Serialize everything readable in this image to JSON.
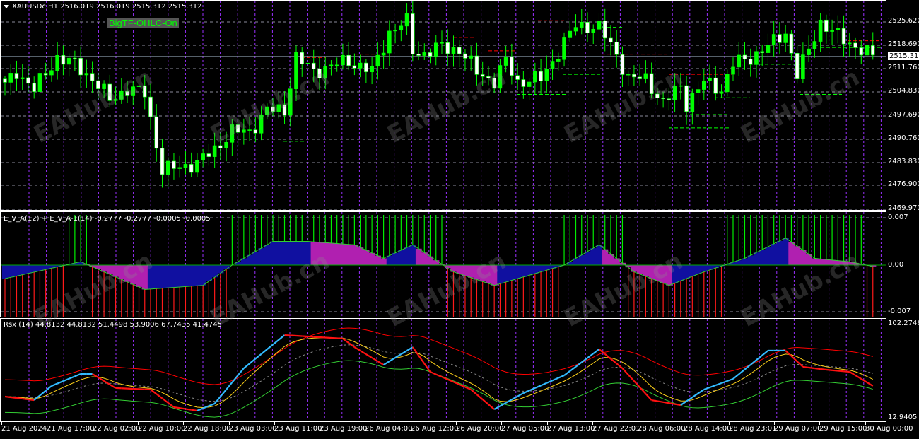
{
  "main": {
    "title": "XAUUSDc,H1  2516.019 2516.019 2515.312 2515.312",
    "badge": "BigTF-OHLC-On",
    "current_price": "2515.312",
    "price_axis": [
      "2525.620",
      "2518.690",
      "2511.760",
      "2504.830",
      "2497.690",
      "2490.760",
      "2483.830",
      "2476.900",
      "2469.970"
    ]
  },
  "indicator1": {
    "label": "E_V_A(12) + E_V_A-1(14) -0.2777 -0.2777 -0.0005 -0.0005",
    "axis": [
      "0.007",
      "0.00",
      "-0.007"
    ]
  },
  "indicator2": {
    "label": "Rsx (14) 44.8132 44.8132 51.4498 53.9006 67.7435 41.4745",
    "axis": [
      "102.2746",
      "12.9405"
    ]
  },
  "time_axis": [
    "21 Aug 2024",
    "21 Aug 17:00",
    "22 Aug 02:00",
    "22 Aug 10:00",
    "22 Aug 18:00",
    "23 Aug 03:00",
    "23 Aug 11:00",
    "23 Aug 19:00",
    "26 Aug 04:00",
    "26 Aug 12:00",
    "26 Aug 20:00",
    "27 Aug 05:00",
    "27 Aug 13:00",
    "27 Aug 22:01",
    "28 Aug 06:00",
    "28 Aug 14:00",
    "28 Aug 23:01",
    "29 Aug 07:00",
    "29 Aug 15:00",
    "30 Aug 00:00"
  ],
  "watermark": "EAHub.cn",
  "colors": {
    "bull": "#00ff00",
    "bear": "#ffffff",
    "grid": "#8a8a9a",
    "period_sep": "#9a30ff",
    "band_up": "#ff0000",
    "band_dn": "#33cc33",
    "rsx_up": "#33bbff",
    "rsx_dn": "#ff1111",
    "signal": "#ffd21a",
    "hist_pos": "#00ee00",
    "hist_neg": "#ff1a1a",
    "fill_up": "#1010a0",
    "fill_dn": "#b020b0"
  },
  "chart_data": {
    "type": "candlestick",
    "symbol": "XAUUSDc",
    "timeframe": "H1",
    "candle_count": 150,
    "ylim": [
      2469.97,
      2529.0
    ],
    "close_anchors": [
      [
        0,
        2506.6
      ],
      [
        2,
        2510.8
      ],
      [
        5,
        2505.5
      ],
      [
        9,
        2515
      ],
      [
        12,
        2513
      ],
      [
        15,
        2508.7
      ],
      [
        18,
        2502.4
      ],
      [
        21,
        2505.5
      ],
      [
        24,
        2504.5
      ],
      [
        27,
        2481.3
      ],
      [
        30,
        2482.4
      ],
      [
        33,
        2483.4
      ],
      [
        36,
        2487.6
      ],
      [
        39,
        2492.9
      ],
      [
        42,
        2492.9
      ],
      [
        45,
        2499.3
      ],
      [
        48,
        2499.3
      ],
      [
        50,
        2515
      ],
      [
        53,
        2510.8
      ],
      [
        57,
        2513
      ],
      [
        59,
        2514
      ],
      [
        63,
        2510.8
      ],
      [
        66,
        2522.5
      ],
      [
        69,
        2525.6
      ],
      [
        70,
        2517.2
      ],
      [
        72,
        2516
      ],
      [
        75,
        2518.3
      ],
      [
        78,
        2517.2
      ],
      [
        81,
        2510.8
      ],
      [
        84,
        2507.7
      ],
      [
        86,
        2514
      ],
      [
        88,
        2507.7
      ],
      [
        92,
        2508.7
      ],
      [
        94,
        2514
      ],
      [
        96,
        2519.3
      ],
      [
        98,
        2524.6
      ],
      [
        102,
        2524
      ],
      [
        105,
        2516
      ],
      [
        107,
        2508.7
      ],
      [
        110,
        2508.7
      ],
      [
        113,
        2501.3
      ],
      [
        116,
        2506.6
      ],
      [
        117,
        2501.3
      ],
      [
        120,
        2507.7
      ],
      [
        123,
        2505.5
      ],
      [
        125,
        2513
      ],
      [
        128,
        2515
      ],
      [
        131,
        2518.3
      ],
      [
        134,
        2522.5
      ],
      [
        136,
        2509.8
      ],
      [
        138,
        2517.2
      ],
      [
        140,
        2525.6
      ],
      [
        143,
        2521.4
      ],
      [
        146,
        2518.3
      ],
      [
        149,
        2515.3
      ]
    ],
    "eva_ylim": [
      -0.007,
      0.007
    ],
    "eva_anchors": [
      [
        0,
        -0.002
      ],
      [
        13,
        0.0005
      ],
      [
        24,
        -0.0036
      ],
      [
        34,
        -0.003
      ],
      [
        39,
        0.0
      ],
      [
        46,
        0.0035
      ],
      [
        52,
        0.0035
      ],
      [
        60,
        0.003
      ],
      [
        65,
        0.001
      ],
      [
        70,
        0.003
      ],
      [
        77,
        -0.001
      ],
      [
        84,
        -0.003
      ],
      [
        96,
        0.0
      ],
      [
        102,
        0.003
      ],
      [
        108,
        -0.001
      ],
      [
        114,
        -0.003
      ],
      [
        120,
        -0.001
      ],
      [
        127,
        0.001
      ],
      [
        134,
        0.004
      ],
      [
        139,
        0.001
      ],
      [
        145,
        0.0005
      ],
      [
        149,
        -0.0002
      ]
    ],
    "rsx_ylim": [
      12.9405,
      102.2746
    ],
    "rsx_anchors": [
      [
        0,
        33.1
      ],
      [
        5,
        29.7
      ],
      [
        8,
        43.2
      ],
      [
        13,
        54.6
      ],
      [
        15,
        54.6
      ],
      [
        19,
        41.2
      ],
      [
        25,
        39.8
      ],
      [
        29,
        23.0
      ],
      [
        33,
        19.7
      ],
      [
        36,
        26.4
      ],
      [
        41,
        60.0
      ],
      [
        48,
        91.5
      ],
      [
        58,
        88.2
      ],
      [
        60,
        80.1
      ],
      [
        65,
        63.3
      ],
      [
        70,
        80.1
      ],
      [
        73,
        56.6
      ],
      [
        80,
        39.8
      ],
      [
        84,
        21.0
      ],
      [
        89,
        36.4
      ],
      [
        96,
        53.2
      ],
      [
        102,
        78.1
      ],
      [
        106,
        60.0
      ],
      [
        111,
        29.7
      ],
      [
        116,
        25.0
      ],
      [
        120,
        39.8
      ],
      [
        125,
        49.9
      ],
      [
        131,
        76.8
      ],
      [
        134,
        76.8
      ],
      [
        137,
        61.3
      ],
      [
        141,
        58.6
      ],
      [
        145,
        56.6
      ],
      [
        149,
        43.2
      ]
    ]
  }
}
